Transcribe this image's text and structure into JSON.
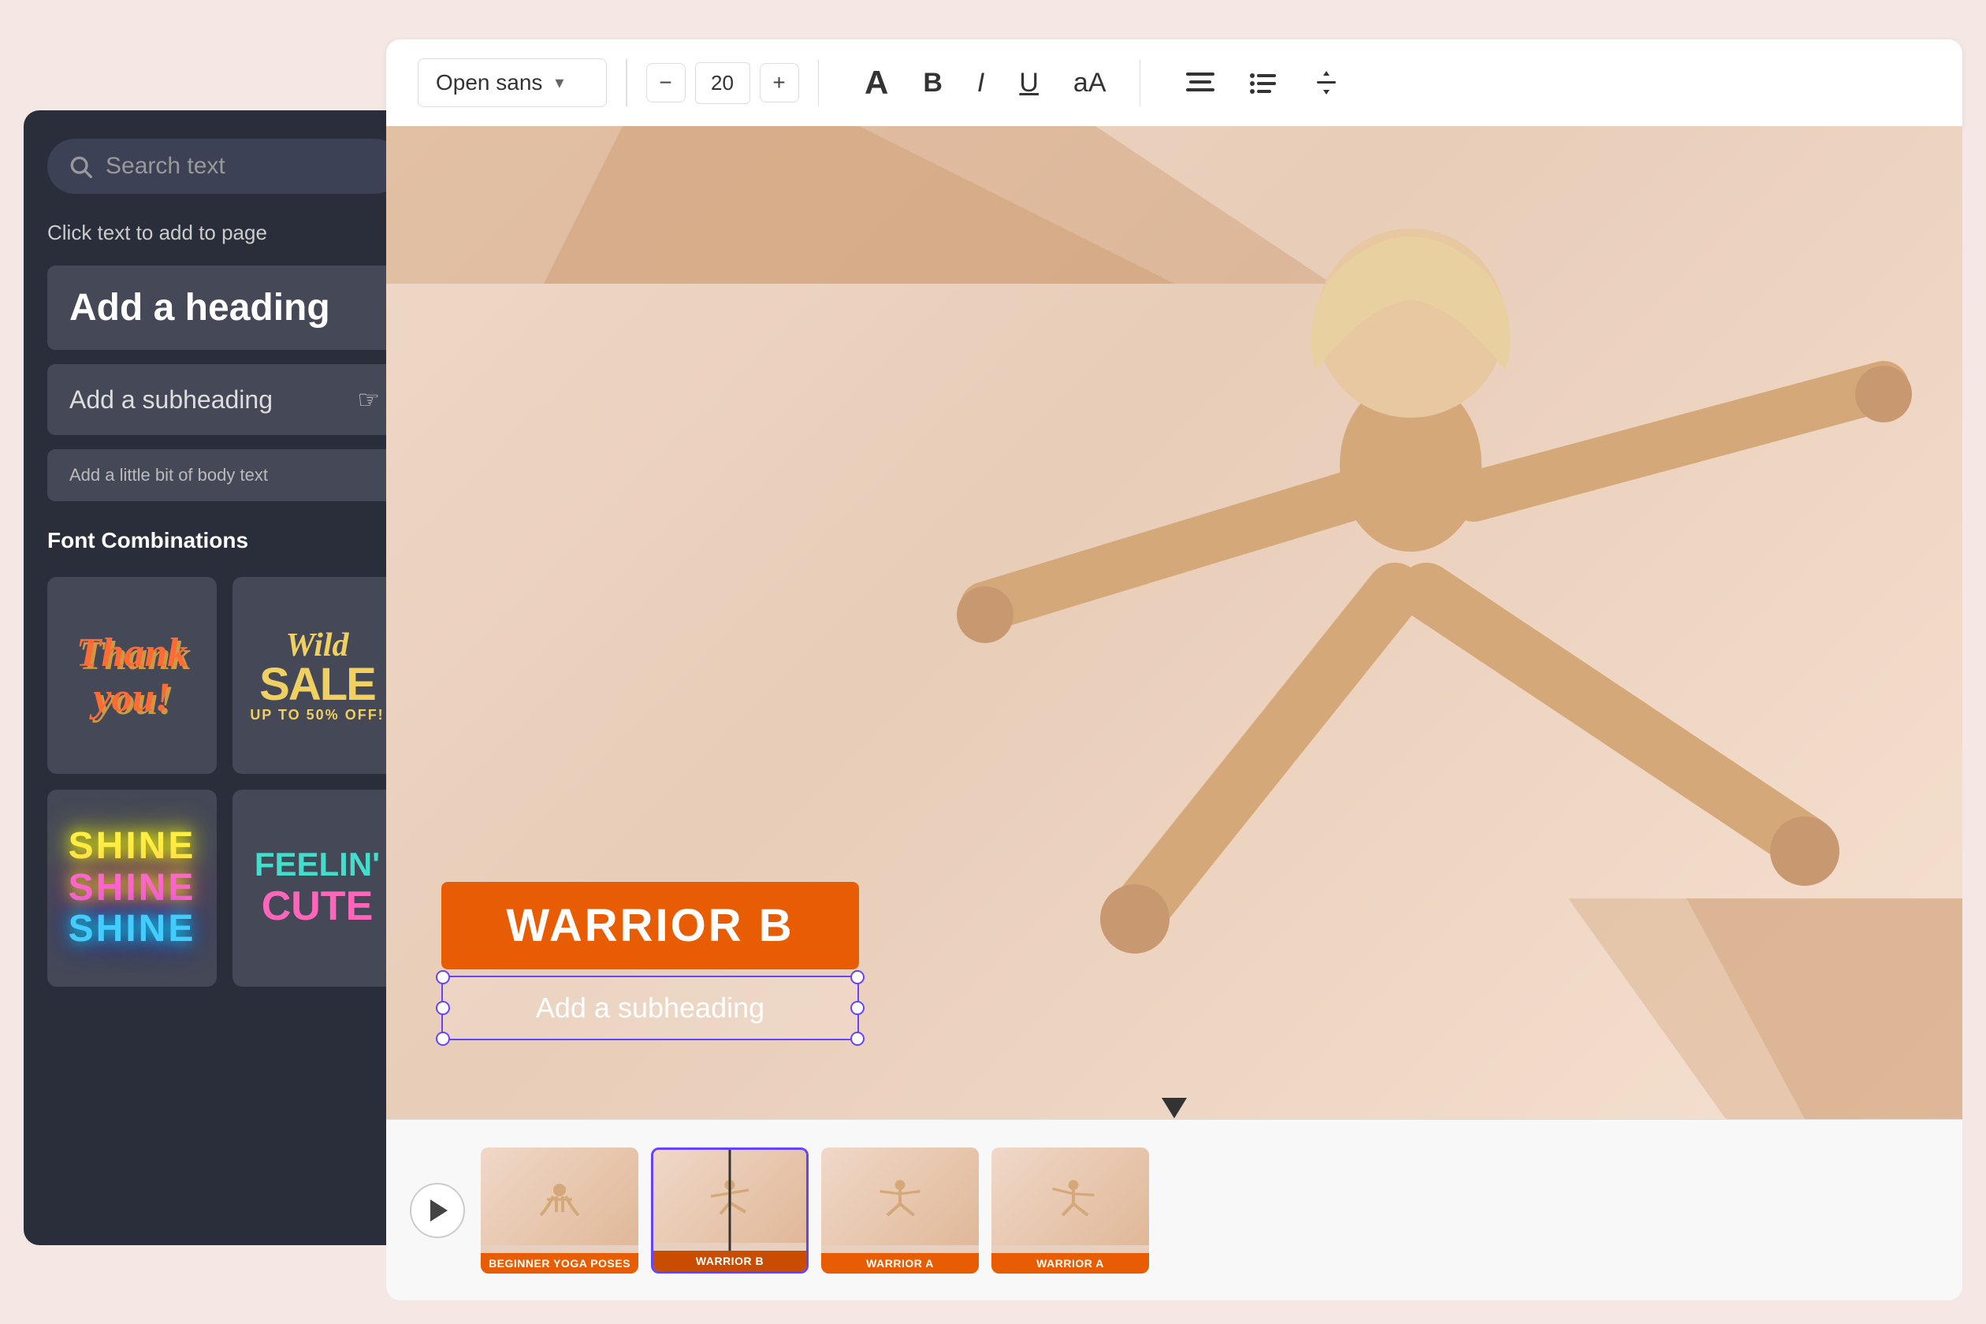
{
  "toolbar": {
    "font_name": "Open sans",
    "font_size": "20",
    "minus_label": "−",
    "plus_label": "+",
    "text_a_large": "A",
    "text_bold": "B",
    "text_italic": "I",
    "text_underline": "U",
    "text_aa": "aA",
    "align_icon": "≡",
    "list_icon": "≔",
    "spacing_icon": "⇕"
  },
  "left_panel": {
    "search_placeholder": "Search text",
    "click_hint": "Click text to add to page",
    "heading_text": "Add a heading",
    "subheading_text": "Add a subheading",
    "body_text": "Add a little bit of body text",
    "font_combinations_title": "Font Combinations",
    "card1_line1": "Thank",
    "card1_line2": "you!",
    "card2_line1": "Wild",
    "card2_line2": "SALE",
    "card2_line3": "UP TO 50% OFF!",
    "card3_line1": "SHINE",
    "card3_line2": "SHINE",
    "card3_line3": "SHINE",
    "card4_line1": "FEELIN'",
    "card4_line2": "CUTE"
  },
  "canvas": {
    "warrior_title": "WARRIOR B",
    "subheading": "Add a subheading"
  },
  "filmstrip": {
    "play_label": "play",
    "thumb1_label": "BEGINNER YOGA POSES",
    "thumb2_label": "WARRIOR B",
    "thumb3_label": "WARRIOR A",
    "thumb4_label": "WARRIOR A"
  }
}
